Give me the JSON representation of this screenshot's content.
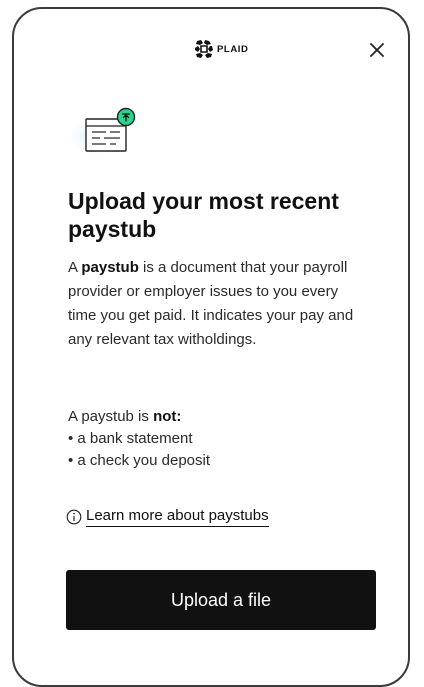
{
  "header": {
    "brand_name": "PLAID",
    "close_label": "×"
  },
  "illustration": {
    "icon": "paystub-document-upload-icon",
    "badge_color": "#2bd68f"
  },
  "title": "Upload your most recent paystub",
  "description": {
    "lead": "A ",
    "term": "paystub",
    "rest": " is a document that your payroll provider or employer issues to you every time you get paid. It indicates your pay and any relevant tax witholdings."
  },
  "not_section": {
    "intro": "A paystub is ",
    "emphasis": "not:",
    "items": [
      "• a bank statement",
      "• a check you deposit"
    ]
  },
  "learn_more": {
    "icon": "info-icon",
    "label": "Learn more about paystubs"
  },
  "primary_button": {
    "label": "Upload a file",
    "color": "#111111"
  }
}
